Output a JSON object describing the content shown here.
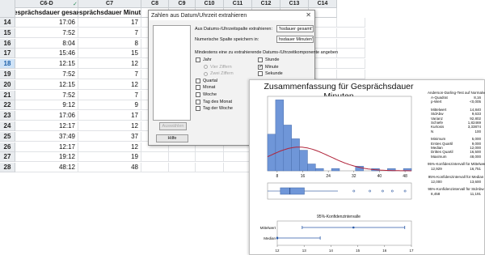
{
  "sheet": {
    "col_letters": [
      "C6-D",
      "C7",
      "C8",
      "C9",
      "C10",
      "C11",
      "C12",
      "C13",
      "C14"
    ],
    "col_names": [
      "Gesprächsdauer gesamt",
      "Gesprächsdauer Minuten"
    ],
    "rows": [
      {
        "num": "14",
        "a": "17:06",
        "b": "17"
      },
      {
        "num": "15",
        "a": "7:52",
        "b": "7"
      },
      {
        "num": "16",
        "a": "8:04",
        "b": "8"
      },
      {
        "num": "17",
        "a": "15:46",
        "b": "15"
      },
      {
        "num": "18",
        "a": "12:15",
        "b": "12"
      },
      {
        "num": "19",
        "a": "7:52",
        "b": "7"
      },
      {
        "num": "20",
        "a": "12:15",
        "b": "12"
      },
      {
        "num": "21",
        "a": "7:52",
        "b": "7"
      },
      {
        "num": "22",
        "a": "9:12",
        "b": "9"
      },
      {
        "num": "23",
        "a": "17:06",
        "b": "17"
      },
      {
        "num": "24",
        "a": "12:17",
        "b": "12"
      },
      {
        "num": "25",
        "a": "37:49",
        "b": "37"
      },
      {
        "num": "26",
        "a": "12:17",
        "b": "12"
      },
      {
        "num": "27",
        "a": "19:12",
        "b": "19"
      },
      {
        "num": "28",
        "a": "48:12",
        "b": "48"
      }
    ]
  },
  "dialog": {
    "title": "Zahlen aus Datum/Uhrzeit extrahieren",
    "close_glyph": "✕",
    "source_label": "Aus Datums-/Uhrzeitspalte extrahieren:",
    "source_value": "'hsdauer gesamt'",
    "target_label": "Numerische Spalte speichern in:",
    "target_value": "hsdauer Minuten'",
    "group_label": "Mindestens eine zu extrahierende Datums-/Uhrzeitkomponente angeben",
    "options_left": [
      {
        "label": "Jahr",
        "checked": false,
        "dim": false
      },
      {
        "label": "Vier Ziffern",
        "radio": true,
        "dim": true
      },
      {
        "label": "Zwei Ziffern",
        "radio": true,
        "dim": true
      },
      {
        "label": "Quartal",
        "checked": false,
        "dim": false
      },
      {
        "label": "Monat",
        "checked": false,
        "dim": false
      },
      {
        "label": "Woche",
        "checked": false,
        "dim": false
      },
      {
        "label": "Tag des Monat",
        "checked": false,
        "dim": false
      },
      {
        "label": "Tag der Woche",
        "checked": false,
        "dim": false
      }
    ],
    "options_right": [
      {
        "label": "Stunde",
        "checked": false
      },
      {
        "label": "Minute",
        "checked": true
      },
      {
        "label": "Sekunde",
        "checked": false
      }
    ],
    "select_button": "Auswählen",
    "help_button": "Hilfe"
  },
  "report": {
    "title": "Zusammenfassung für Gesprächsdauer Minuten",
    "ad_head": "Anderson-Darling-Test auf Normalverteilung",
    "ad_rows": [
      [
        "A-Quadrat",
        "8,16"
      ],
      [
        "p-Wert",
        "<0,005"
      ]
    ],
    "desc_rows": [
      [
        "Mittelwert",
        "14,840"
      ],
      [
        "StdAbw",
        "9,633"
      ],
      [
        "Varianz",
        "92,802"
      ],
      [
        "Schiefe",
        "1,82469"
      ],
      [
        "Kurtosis",
        "3,33874"
      ],
      [
        "N",
        "100"
      ]
    ],
    "quart_rows": [
      [
        "Minimum",
        "5,000"
      ],
      [
        "Erstes Quartil",
        "9,000"
      ],
      [
        "Median",
        "12,000"
      ],
      [
        "Drittes Quartil",
        "16,500"
      ],
      [
        "Maximum",
        "48,000"
      ]
    ],
    "ci_mean_head": "95%-Konfidenzintervall für Mittelwert",
    "ci_mean_vals": [
      "12,929",
      "16,751"
    ],
    "ci_median_head": "95%-Konfidenzintervall für Median",
    "ci_median_vals": [
      "12,000",
      "13,600"
    ],
    "ci_sd_head": "95%-Konfidenzintervall für StdAbw",
    "ci_sd_vals": [
      "8,458",
      "11,191"
    ],
    "ci_title": "95%-Konfidenzintervalle",
    "ci_labels": [
      "Mittelwert",
      "Median"
    ],
    "hist_ticks": [
      "8",
      "16",
      "24",
      "32",
      "40",
      "48"
    ],
    "ci_ticks": [
      "12",
      "13",
      "14",
      "15",
      "16",
      "17"
    ],
    "colors": {
      "bar": "#6f96d8",
      "bar_edge": "#4a6fae",
      "curve": "#b0243a",
      "ci": "#2b5aa8"
    }
  },
  "chart_data": [
    {
      "type": "bar",
      "title": "",
      "xlabel": "",
      "ylabel": "",
      "x_ticks": [
        8,
        16,
        24,
        32,
        40,
        48
      ],
      "bins": [
        5,
        7.5,
        10,
        12.5,
        15,
        17.5,
        20,
        22.5,
        25,
        27.5,
        30,
        32.5,
        35,
        37.5,
        40,
        42.5,
        45,
        47.5,
        50
      ],
      "values": [
        16,
        31,
        20,
        14,
        9,
        3,
        1,
        0,
        1,
        0,
        0,
        2,
        0,
        1,
        0,
        1,
        0,
        1
      ],
      "overlay": {
        "type": "normal-curve",
        "mean": 14.84,
        "sd": 9.633
      }
    },
    {
      "type": "boxplot",
      "min": 5,
      "q1": 9,
      "median": 12,
      "q3": 16.5,
      "whisker_high": 27,
      "outliers": [
        32,
        37,
        41,
        44,
        48
      ]
    },
    {
      "type": "interval",
      "x_ticks": [
        12,
        13,
        14,
        15,
        16,
        17
      ],
      "series": [
        {
          "name": "Mittelwert",
          "low": 12.929,
          "estimate": 14.84,
          "high": 16.751
        },
        {
          "name": "Median",
          "low": 12.0,
          "estimate": 12.0,
          "high": 13.6
        }
      ]
    }
  ]
}
